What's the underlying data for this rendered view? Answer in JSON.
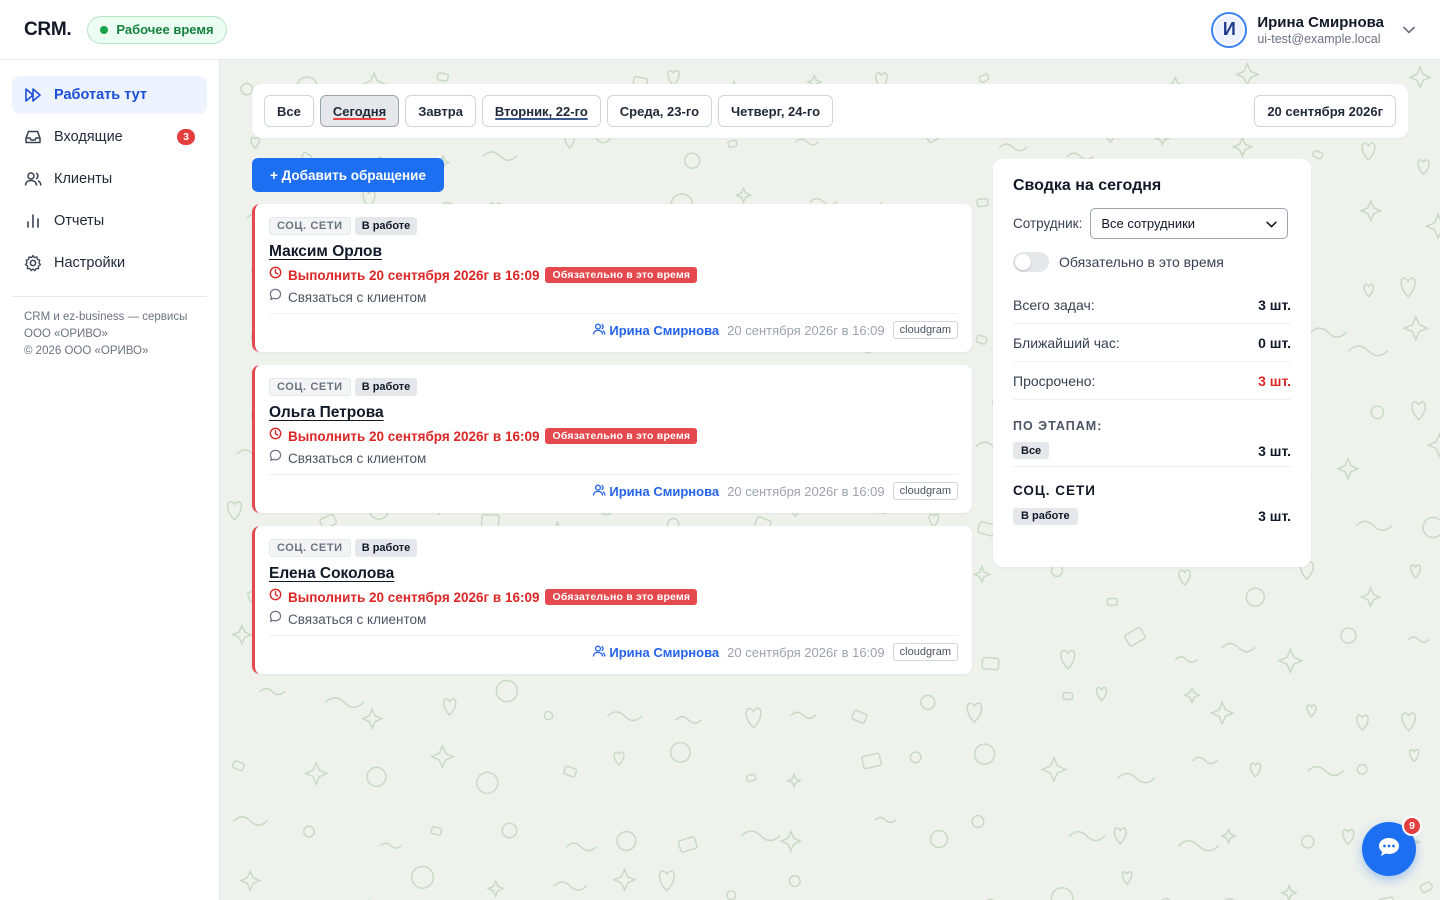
{
  "header": {
    "logo": "CRM.",
    "work_status": "Рабочее время",
    "user": {
      "initial": "И",
      "name": "Ирина Смирнова",
      "email": "ui-test@example.local"
    }
  },
  "sidebar": {
    "items": [
      {
        "label": "Работать тут",
        "icon": "fast-forward-icon",
        "active": true
      },
      {
        "label": "Входящие",
        "icon": "inbox-icon",
        "badge": "3"
      },
      {
        "label": "Клиенты",
        "icon": "users-icon"
      },
      {
        "label": "Отчеты",
        "icon": "bar-chart-icon"
      },
      {
        "label": "Настройки",
        "icon": "gear-icon"
      }
    ],
    "footer": {
      "line1": "CRM и ez-business — сервисы",
      "line2": "ООО «ОРИВО»",
      "line3": "© 2026 ООО «ОРИВО»"
    }
  },
  "filters": {
    "buttons": [
      "Все",
      "Сегодня",
      "Завтра",
      "Вторник, 22-го",
      "Среда, 23-го",
      "Четверг, 24-го"
    ],
    "active": "Сегодня",
    "date": "20 сентября 2026г"
  },
  "add_button": "+ Добавить обращение",
  "cards": [
    {
      "source": "СОЦ. СЕТИ",
      "stage": "В работе",
      "client": "Максим Орлов",
      "deadline": "Выполнить 20 сентября 2026г в 16:09",
      "required": "Обязательно в это время",
      "task": "Связаться с клиентом",
      "assignee": "Ирина Смирнова",
      "created": "20 сентября 2026г в 16:09",
      "channel": "cloudgram"
    },
    {
      "source": "СОЦ. СЕТИ",
      "stage": "В работе",
      "client": "Ольга Петрова",
      "deadline": "Выполнить 20 сентября 2026г в 16:09",
      "required": "Обязательно в это время",
      "task": "Связаться с клиентом",
      "assignee": "Ирина Смирнова",
      "created": "20 сентября 2026г в 16:09",
      "channel": "cloudgram"
    },
    {
      "source": "СОЦ. СЕТИ",
      "stage": "В работе",
      "client": "Елена Соколова",
      "deadline": "Выполнить 20 сентября 2026г в 16:09",
      "required": "Обязательно в это время",
      "task": "Связаться с клиентом",
      "assignee": "Ирина Смирнова",
      "created": "20 сентября 2026г в 16:09",
      "channel": "cloudgram"
    }
  ],
  "summary": {
    "title": "Сводка на сегодня",
    "employee_label": "Сотрудник:",
    "employee_value": "Все сотрудники",
    "toggle_label": "Обязательно в это время",
    "toggle_on": false,
    "stats": [
      {
        "label": "Всего задач:",
        "value": "3 шт."
      },
      {
        "label": "Ближайший час:",
        "value": "0 шт."
      },
      {
        "label": "Просрочено:",
        "value": "3 шт.",
        "highlight": "#dc2626"
      }
    ],
    "stages_title": "ПО ЭТАПАМ:",
    "stages": [
      {
        "label": "Все",
        "value": "3 шт."
      }
    ],
    "source_title": "СОЦ. СЕТИ",
    "source_stages": [
      {
        "label": "В работе",
        "value": "3 шт."
      }
    ]
  },
  "chat": {
    "badge": "9"
  },
  "colors": {
    "accent": "#1d6ff2",
    "danger": "#e5484d",
    "success": "#16a34a",
    "pattern": "#b9d0b4"
  }
}
